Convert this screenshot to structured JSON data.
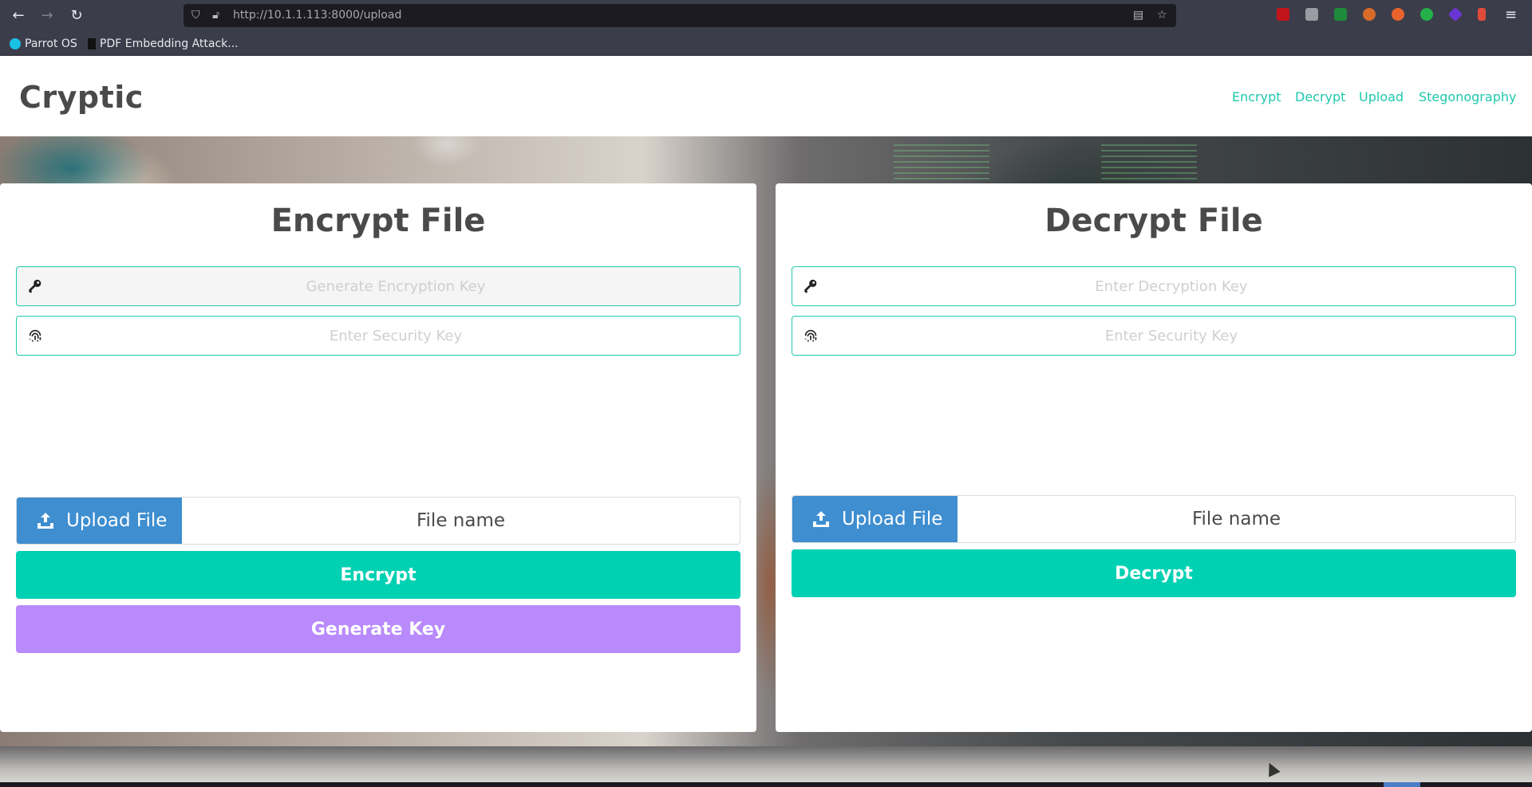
{
  "browser": {
    "url": "http://10.1.1.113:8000/upload",
    "bookmarks": [
      "Parrot OS",
      "PDF Embedding Attack..."
    ],
    "extensions": [
      {
        "name": "ublock-icon",
        "color": "#c3141b"
      },
      {
        "name": "s-ext-icon",
        "color": "#9b9ba3"
      },
      {
        "name": "w-ext-icon",
        "color": "#1e8a3c"
      },
      {
        "name": "cookie-ext-icon",
        "color": "#d96b2a"
      },
      {
        "name": "fox-ext-icon",
        "color": "#e8632b"
      },
      {
        "name": "check-ext-icon",
        "color": "#24b14a"
      },
      {
        "name": "cube-ext-icon",
        "color": "#6a35d4"
      },
      {
        "name": "bars-ext-icon",
        "color": "#e14b3b"
      }
    ]
  },
  "site": {
    "brand": "Cryptic",
    "nav": [
      "Encrypt",
      "Decrypt",
      "Upload",
      "Stegonography"
    ]
  },
  "encrypt": {
    "title": "Encrypt File",
    "key_placeholder": "Generate Encryption Key",
    "security_placeholder": "Enter Security Key",
    "upload_label": "Upload File",
    "file_name": "File name",
    "encrypt_label": "Encrypt",
    "generate_label": "Generate Key"
  },
  "decrypt": {
    "title": "Decrypt File",
    "key_placeholder": "Enter Decryption Key",
    "security_placeholder": "Enter Security Key",
    "upload_label": "Upload File",
    "file_name": "File name",
    "decrypt_label": "Decrypt"
  },
  "colors": {
    "accent": "#00d1b2",
    "link": "#1ec8ad",
    "upload": "#3e8ed0",
    "generate": "#b88afc"
  }
}
